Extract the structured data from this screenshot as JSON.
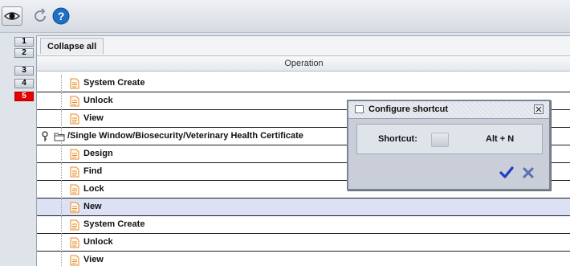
{
  "toolbar": {
    "buttons": [
      {
        "name": "view-toggle",
        "icon": "eye-icon"
      },
      {
        "name": "refresh",
        "icon": "refresh-icon"
      },
      {
        "name": "help",
        "icon": "help-icon",
        "label": "?"
      }
    ]
  },
  "level_tabs": [
    {
      "label": "1",
      "active": false
    },
    {
      "label": "2",
      "active": false
    },
    {
      "label": "3",
      "active": false
    },
    {
      "label": "4",
      "active": false
    },
    {
      "label": "5",
      "active": true
    }
  ],
  "panel": {
    "collapse_label": "Collapse all",
    "column_header": "Operation",
    "rows": [
      {
        "type": "leaf",
        "label": "System Create",
        "selected": false
      },
      {
        "type": "leaf",
        "label": "Unlock",
        "selected": false
      },
      {
        "type": "leaf",
        "label": "View",
        "selected": false
      },
      {
        "type": "folder",
        "label": "/Single Window/Biosecurity/Veterinary Health Certificate",
        "selected": false
      },
      {
        "type": "leaf",
        "label": "Design",
        "selected": false
      },
      {
        "type": "leaf",
        "label": "Find",
        "selected": false
      },
      {
        "type": "leaf",
        "label": "Lock",
        "selected": false
      },
      {
        "type": "leaf",
        "label": "New",
        "selected": true
      },
      {
        "type": "leaf",
        "label": "System Create",
        "selected": false
      },
      {
        "type": "leaf",
        "label": "Unlock",
        "selected": false
      },
      {
        "type": "leaf",
        "label": "View",
        "selected": false
      }
    ]
  },
  "dialog": {
    "title": "Configure shortcut",
    "field_label": "Shortcut:",
    "shortcut_value": "Alt + N",
    "ok_icon": "checkmark-icon",
    "cancel_icon": "x-icon"
  },
  "colors": {
    "active_tab": "#e60000",
    "selected_row": "#dde1f6",
    "help_blue": "#1f6fc4",
    "ok_blue": "#1f3fbf",
    "cancel_blue": "#5a6fb0"
  }
}
